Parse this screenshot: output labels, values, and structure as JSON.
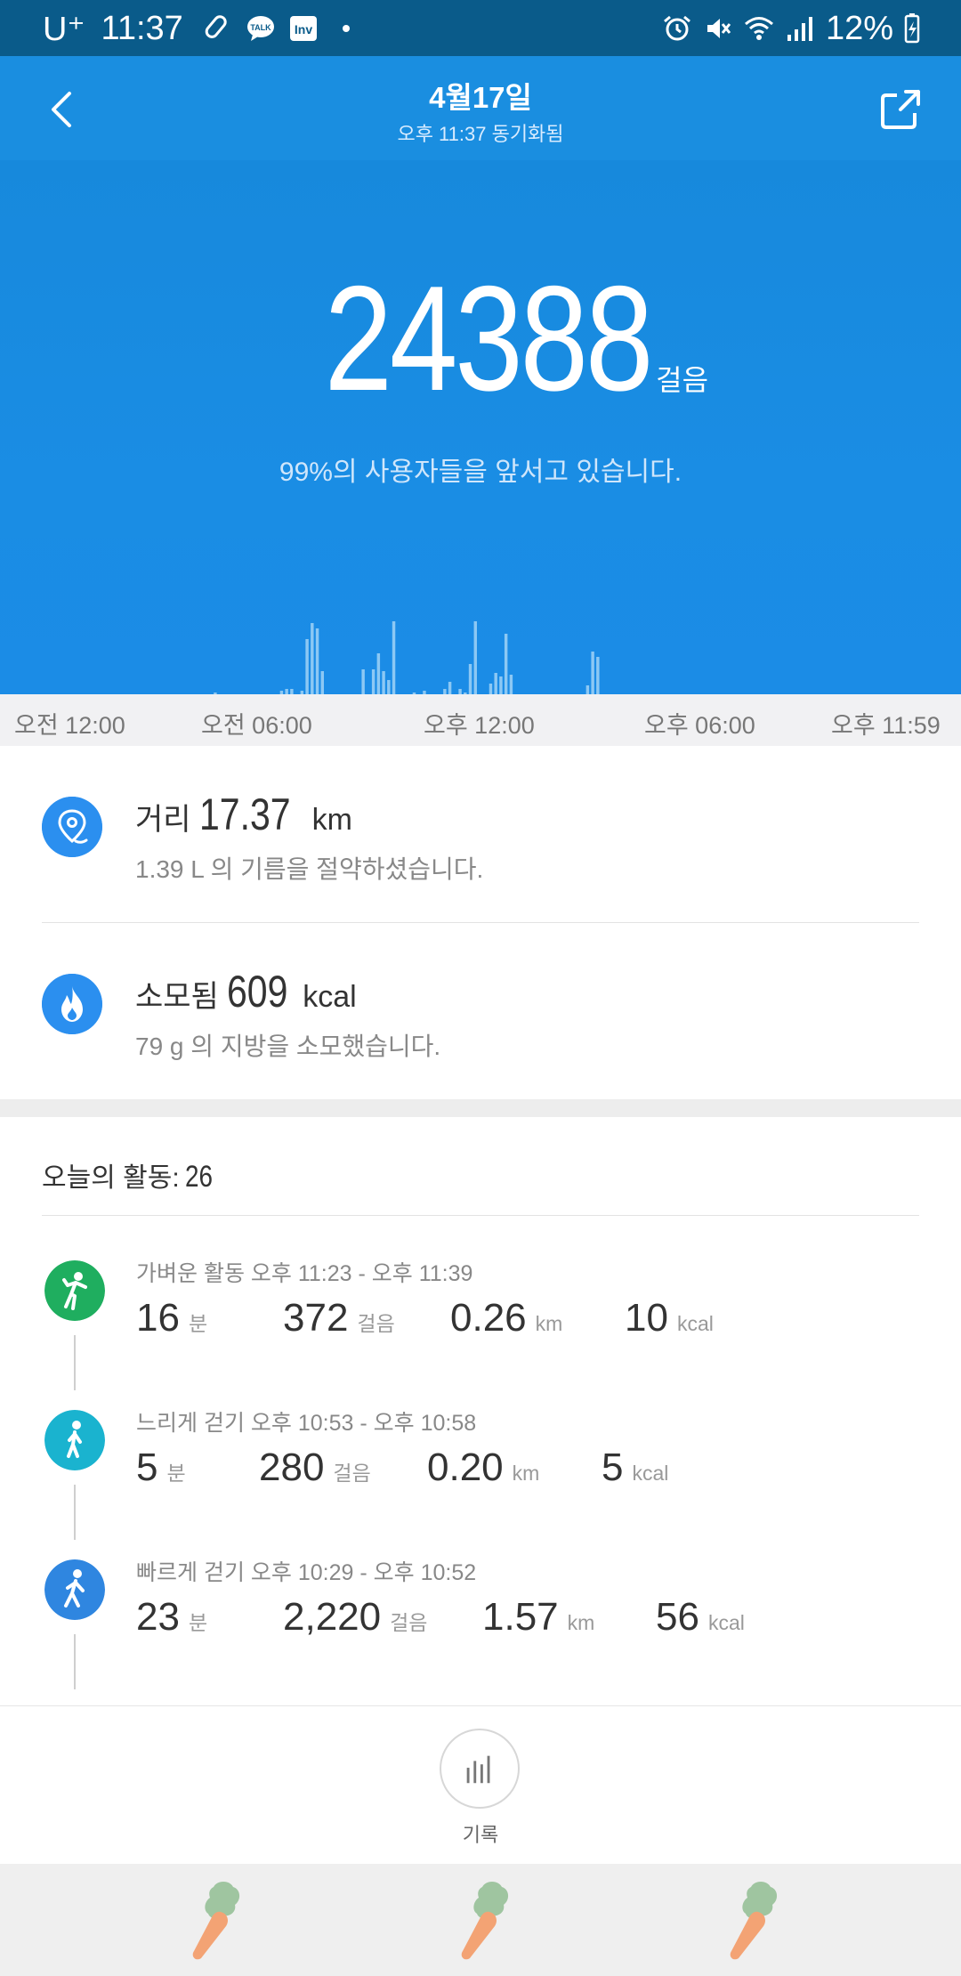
{
  "status_bar": {
    "carrier": "U⁺",
    "time": "11:37",
    "battery": "12%"
  },
  "header": {
    "title": "4월17일",
    "sync_status": "오후 11:37 동기화됨"
  },
  "hero": {
    "steps": "24388",
    "steps_unit": "걸음",
    "rank_text": "99%의 사용자들을 앞서고 있습니다."
  },
  "chart_data": {
    "type": "bar",
    "xlabel": "",
    "ylabel": "",
    "x_ticks": [
      "오전 12:00",
      "오전 06:00",
      "오후 12:00",
      "오후 06:00",
      "오후 11:59"
    ],
    "bins_per_day": 144,
    "values": [
      0,
      0,
      0,
      0,
      0,
      0,
      0,
      0,
      0,
      0,
      0,
      0,
      0,
      0,
      0,
      0,
      0,
      0,
      0,
      0,
      0,
      0,
      0,
      0,
      0,
      0,
      0,
      0,
      0,
      0,
      0,
      0,
      0,
      0,
      0,
      0,
      0,
      0,
      0,
      0,
      0,
      1,
      0,
      0,
      0,
      0,
      0,
      0,
      0,
      0,
      0,
      0,
      0,
      0,
      2,
      3,
      3,
      0,
      2,
      31,
      40,
      37,
      13,
      0,
      0,
      0,
      0,
      0,
      0,
      0,
      14,
      0,
      14,
      23,
      13,
      8,
      41,
      0,
      0,
      0,
      1,
      0,
      2,
      0,
      0,
      0,
      3,
      7,
      0,
      3,
      1,
      17,
      41,
      0,
      0,
      6,
      12,
      10,
      34,
      11,
      0,
      0,
      0,
      0,
      0,
      0,
      0,
      0,
      0,
      0,
      0,
      0,
      0,
      0,
      5,
      24,
      21,
      0,
      0,
      0,
      0,
      0,
      0,
      0,
      0,
      0,
      0,
      0,
      0,
      0,
      0,
      0,
      0,
      0,
      0,
      0,
      0,
      0,
      0,
      0,
      0,
      0,
      0,
      0,
      0,
      0,
      0,
      0,
      0,
      0,
      0,
      0,
      0,
      0,
      0,
      0,
      0,
      0,
      0,
      0,
      0,
      0,
      0,
      0,
      0,
      0,
      0,
      0,
      0,
      0,
      0,
      0,
      0,
      0,
      0,
      0,
      0,
      0,
      0,
      0,
      0,
      0,
      0,
      0,
      0,
      0,
      0
    ],
    "ylim": [
      0,
      100
    ]
  },
  "summary": {
    "distance": {
      "label": "거리",
      "value": "17.37",
      "unit": "km",
      "sub": "1.39 L 의 기름을 절약하셨습니다."
    },
    "calories": {
      "label": "소모됨",
      "value": "609",
      "unit": "kcal",
      "sub": "79 g 의 지방을 소모했습니다."
    }
  },
  "activities": {
    "title": "오늘의 활동:",
    "count": "26",
    "items": [
      {
        "type": "가벼운 활동",
        "time": "오후 11:23 - 오후 11:39",
        "duration": "16",
        "duration_unit": "분",
        "steps": "372",
        "steps_unit": "걸음",
        "distance": "0.26",
        "distance_unit": "km",
        "calories": "10",
        "calories_unit": "kcal",
        "color": "#1fae5f"
      },
      {
        "type": "느리게 걷기",
        "time": "오후 10:53 - 오후 10:58",
        "duration": "5",
        "duration_unit": "분",
        "steps": "280",
        "steps_unit": "걸음",
        "distance": "0.20",
        "distance_unit": "km",
        "calories": "5",
        "calories_unit": "kcal",
        "color": "#1ab3cf"
      },
      {
        "type": "빠르게 걷기",
        "time": "오후 10:29 - 오후 10:52",
        "duration": "23",
        "duration_unit": "분",
        "steps": "2,220",
        "steps_unit": "걸음",
        "distance": "1.57",
        "distance_unit": "km",
        "calories": "56",
        "calories_unit": "kcal",
        "color": "#2f86e0"
      }
    ]
  },
  "bottom": {
    "records_label": "기록"
  },
  "colors": {
    "header_bg": "#1a8ee0",
    "hero_bg": "#1789dc",
    "accent": "#2b8fef",
    "status_bar_bg": "#0a5b8a"
  }
}
